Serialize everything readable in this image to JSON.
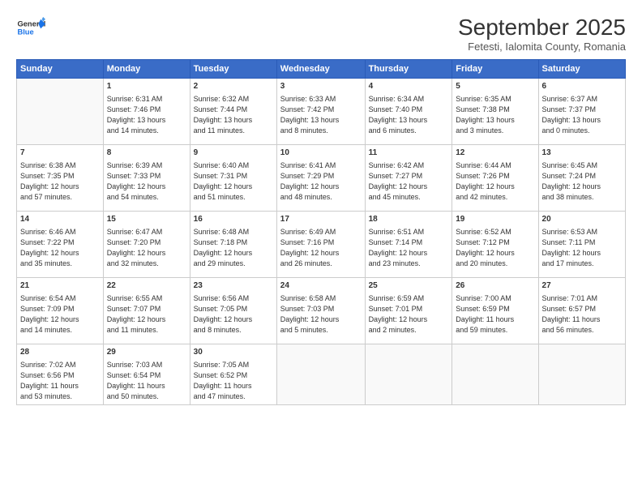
{
  "header": {
    "logo_line1": "General",
    "logo_line2": "Blue",
    "month": "September 2025",
    "location": "Fetesti, Ialomita County, Romania"
  },
  "weekdays": [
    "Sunday",
    "Monday",
    "Tuesday",
    "Wednesday",
    "Thursday",
    "Friday",
    "Saturday"
  ],
  "weeks": [
    [
      {
        "day": "",
        "info": ""
      },
      {
        "day": "1",
        "info": "Sunrise: 6:31 AM\nSunset: 7:46 PM\nDaylight: 13 hours\nand 14 minutes."
      },
      {
        "day": "2",
        "info": "Sunrise: 6:32 AM\nSunset: 7:44 PM\nDaylight: 13 hours\nand 11 minutes."
      },
      {
        "day": "3",
        "info": "Sunrise: 6:33 AM\nSunset: 7:42 PM\nDaylight: 13 hours\nand 8 minutes."
      },
      {
        "day": "4",
        "info": "Sunrise: 6:34 AM\nSunset: 7:40 PM\nDaylight: 13 hours\nand 6 minutes."
      },
      {
        "day": "5",
        "info": "Sunrise: 6:35 AM\nSunset: 7:38 PM\nDaylight: 13 hours\nand 3 minutes."
      },
      {
        "day": "6",
        "info": "Sunrise: 6:37 AM\nSunset: 7:37 PM\nDaylight: 13 hours\nand 0 minutes."
      }
    ],
    [
      {
        "day": "7",
        "info": "Sunrise: 6:38 AM\nSunset: 7:35 PM\nDaylight: 12 hours\nand 57 minutes."
      },
      {
        "day": "8",
        "info": "Sunrise: 6:39 AM\nSunset: 7:33 PM\nDaylight: 12 hours\nand 54 minutes."
      },
      {
        "day": "9",
        "info": "Sunrise: 6:40 AM\nSunset: 7:31 PM\nDaylight: 12 hours\nand 51 minutes."
      },
      {
        "day": "10",
        "info": "Sunrise: 6:41 AM\nSunset: 7:29 PM\nDaylight: 12 hours\nand 48 minutes."
      },
      {
        "day": "11",
        "info": "Sunrise: 6:42 AM\nSunset: 7:27 PM\nDaylight: 12 hours\nand 45 minutes."
      },
      {
        "day": "12",
        "info": "Sunrise: 6:44 AM\nSunset: 7:26 PM\nDaylight: 12 hours\nand 42 minutes."
      },
      {
        "day": "13",
        "info": "Sunrise: 6:45 AM\nSunset: 7:24 PM\nDaylight: 12 hours\nand 38 minutes."
      }
    ],
    [
      {
        "day": "14",
        "info": "Sunrise: 6:46 AM\nSunset: 7:22 PM\nDaylight: 12 hours\nand 35 minutes."
      },
      {
        "day": "15",
        "info": "Sunrise: 6:47 AM\nSunset: 7:20 PM\nDaylight: 12 hours\nand 32 minutes."
      },
      {
        "day": "16",
        "info": "Sunrise: 6:48 AM\nSunset: 7:18 PM\nDaylight: 12 hours\nand 29 minutes."
      },
      {
        "day": "17",
        "info": "Sunrise: 6:49 AM\nSunset: 7:16 PM\nDaylight: 12 hours\nand 26 minutes."
      },
      {
        "day": "18",
        "info": "Sunrise: 6:51 AM\nSunset: 7:14 PM\nDaylight: 12 hours\nand 23 minutes."
      },
      {
        "day": "19",
        "info": "Sunrise: 6:52 AM\nSunset: 7:12 PM\nDaylight: 12 hours\nand 20 minutes."
      },
      {
        "day": "20",
        "info": "Sunrise: 6:53 AM\nSunset: 7:11 PM\nDaylight: 12 hours\nand 17 minutes."
      }
    ],
    [
      {
        "day": "21",
        "info": "Sunrise: 6:54 AM\nSunset: 7:09 PM\nDaylight: 12 hours\nand 14 minutes."
      },
      {
        "day": "22",
        "info": "Sunrise: 6:55 AM\nSunset: 7:07 PM\nDaylight: 12 hours\nand 11 minutes."
      },
      {
        "day": "23",
        "info": "Sunrise: 6:56 AM\nSunset: 7:05 PM\nDaylight: 12 hours\nand 8 minutes."
      },
      {
        "day": "24",
        "info": "Sunrise: 6:58 AM\nSunset: 7:03 PM\nDaylight: 12 hours\nand 5 minutes."
      },
      {
        "day": "25",
        "info": "Sunrise: 6:59 AM\nSunset: 7:01 PM\nDaylight: 12 hours\nand 2 minutes."
      },
      {
        "day": "26",
        "info": "Sunrise: 7:00 AM\nSunset: 6:59 PM\nDaylight: 11 hours\nand 59 minutes."
      },
      {
        "day": "27",
        "info": "Sunrise: 7:01 AM\nSunset: 6:57 PM\nDaylight: 11 hours\nand 56 minutes."
      }
    ],
    [
      {
        "day": "28",
        "info": "Sunrise: 7:02 AM\nSunset: 6:56 PM\nDaylight: 11 hours\nand 53 minutes."
      },
      {
        "day": "29",
        "info": "Sunrise: 7:03 AM\nSunset: 6:54 PM\nDaylight: 11 hours\nand 50 minutes."
      },
      {
        "day": "30",
        "info": "Sunrise: 7:05 AM\nSunset: 6:52 PM\nDaylight: 11 hours\nand 47 minutes."
      },
      {
        "day": "",
        "info": ""
      },
      {
        "day": "",
        "info": ""
      },
      {
        "day": "",
        "info": ""
      },
      {
        "day": "",
        "info": ""
      }
    ]
  ]
}
